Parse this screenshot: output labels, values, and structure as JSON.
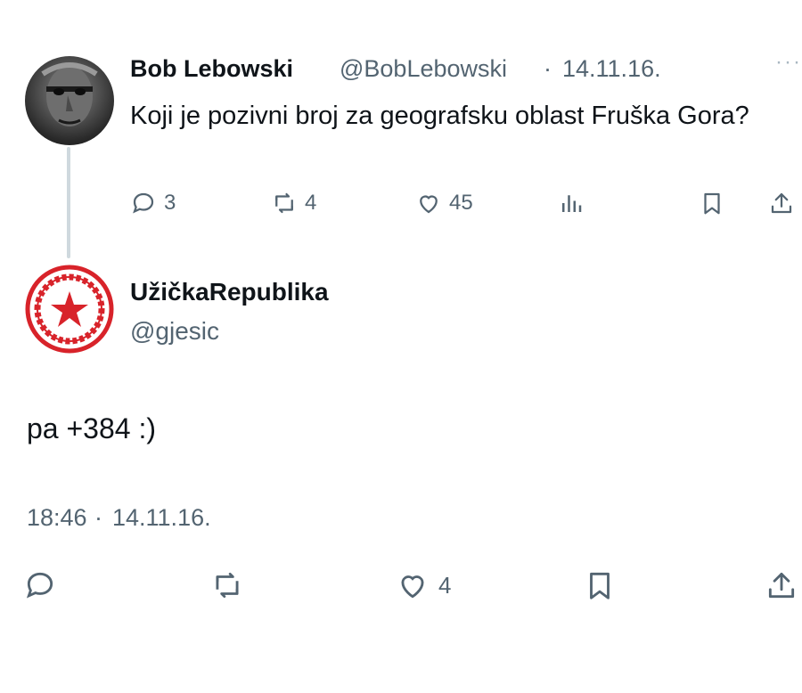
{
  "tweet1": {
    "author_name": "Bob Lebowski",
    "author_handle": "@BobLebowski",
    "separator": "·",
    "date": "14.11.16.",
    "more": "···",
    "text": "Koji je pozivni broj za geografsku oblast Fruška Gora?",
    "stats": {
      "replies": "3",
      "retweets": "4",
      "likes": "45"
    }
  },
  "tweet2": {
    "author_name": "UžičkaRepublika",
    "author_handle": "@gjesic",
    "text": "pa +384 :)",
    "time": "18:46",
    "separator": "·",
    "date": "14.11.16.",
    "stats": {
      "likes": "4"
    }
  },
  "colors": {
    "secondary_text": "#536471",
    "thread_line": "#cfd9de",
    "logo_red": "#d8232a"
  },
  "icons": [
    "reply-icon",
    "retweet-icon",
    "like-icon",
    "views-icon",
    "bookmark-icon",
    "share-icon",
    "more-icon"
  ]
}
